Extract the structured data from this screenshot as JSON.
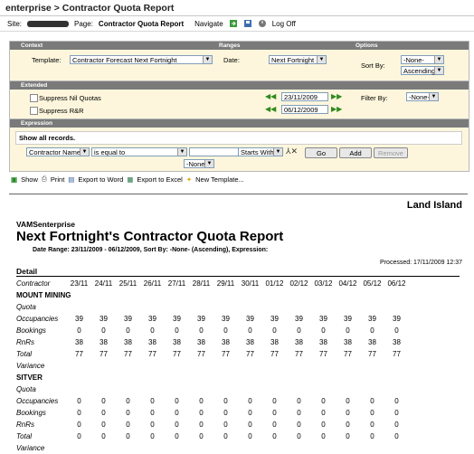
{
  "title": "enterprise > Contractor Quota Report",
  "site_label": "Site:",
  "page_label": "Page:",
  "page_name": "Contractor Quota Report",
  "navigate": "Navigate",
  "logoff": "Log Off",
  "sections": {
    "context": "Context",
    "ranges": "Ranges",
    "options": "Options",
    "extended": "Extended",
    "expression": "Expression"
  },
  "context": {
    "template_label": "Template:",
    "template_value": "Contractor Forecast Next Fortnight",
    "date_label": "Date:",
    "date_value": "Next Fortnight",
    "sortby_label": "Sort By:",
    "sort_none": "-None-",
    "sort_dir": "Ascending"
  },
  "extended": {
    "suppress_nil": "Suppress Nil Quotas",
    "suppress_rr": "Suppress R&R",
    "from_date": "23/11/2009",
    "to_date": "06/12/2009",
    "filterby_label": "Filter By:",
    "filter_value": "-None-"
  },
  "expression": {
    "show_all": "Show all records.",
    "field": "Contractor Name",
    "op": "is equal to",
    "match": "Starts With",
    "none": "-None-",
    "go": "Go",
    "add": "Add",
    "remove": "Remove"
  },
  "toolbar": {
    "show": "Show",
    "print": "Print",
    "word": "Export to Word",
    "excel": "Export to Excel",
    "new_tpl": "New Template..."
  },
  "report": {
    "company": "Land Island",
    "org": "VAMSenterprise",
    "title": "Next Fortnight's Contractor Quota Report",
    "subtitle": "Date Range: 23/11/2009 - 06/12/2009, Sort By: -None- (Ascending), Expression:",
    "processed": "Processed: 17/11/2009 12:37",
    "detail": "Detail",
    "contractor_label": "Contractor",
    "dates": [
      "23/11",
      "24/11",
      "25/11",
      "26/11",
      "27/11",
      "28/11",
      "29/11",
      "30/11",
      "01/12",
      "02/12",
      "03/12",
      "04/12",
      "05/12",
      "06/12"
    ],
    "groups": [
      {
        "name": "MOUNT MINING",
        "rows": [
          {
            "label": "Quota",
            "values": []
          },
          {
            "label": "Occupancies",
            "values": [
              "39",
              "39",
              "39",
              "39",
              "39",
              "39",
              "39",
              "39",
              "39",
              "39",
              "39",
              "39",
              "39",
              "39"
            ]
          },
          {
            "label": "Bookings",
            "values": [
              "0",
              "0",
              "0",
              "0",
              "0",
              "0",
              "0",
              "0",
              "0",
              "0",
              "0",
              "0",
              "0",
              "0"
            ]
          },
          {
            "label": "RnRs",
            "values": [
              "38",
              "38",
              "38",
              "38",
              "38",
              "38",
              "38",
              "38",
              "38",
              "38",
              "38",
              "38",
              "38",
              "38"
            ]
          },
          {
            "label": "Total",
            "values": [
              "77",
              "77",
              "77",
              "77",
              "77",
              "77",
              "77",
              "77",
              "77",
              "77",
              "77",
              "77",
              "77",
              "77"
            ]
          },
          {
            "label": "Variance",
            "values": []
          }
        ]
      },
      {
        "name": "SITVER",
        "rows": [
          {
            "label": "Quota",
            "values": []
          },
          {
            "label": "Occupancies",
            "values": [
              "0",
              "0",
              "0",
              "0",
              "0",
              "0",
              "0",
              "0",
              "0",
              "0",
              "0",
              "0",
              "0",
              "0"
            ]
          },
          {
            "label": "Bookings",
            "values": [
              "0",
              "0",
              "0",
              "0",
              "0",
              "0",
              "0",
              "0",
              "0",
              "0",
              "0",
              "0",
              "0",
              "0"
            ]
          },
          {
            "label": "RnRs",
            "values": [
              "0",
              "0",
              "0",
              "0",
              "0",
              "0",
              "0",
              "0",
              "0",
              "0",
              "0",
              "0",
              "0",
              "0"
            ]
          },
          {
            "label": "Total",
            "values": [
              "0",
              "0",
              "0",
              "0",
              "0",
              "0",
              "0",
              "0",
              "0",
              "0",
              "0",
              "0",
              "0",
              "0"
            ]
          },
          {
            "label": "Variance",
            "values": []
          }
        ]
      }
    ]
  }
}
